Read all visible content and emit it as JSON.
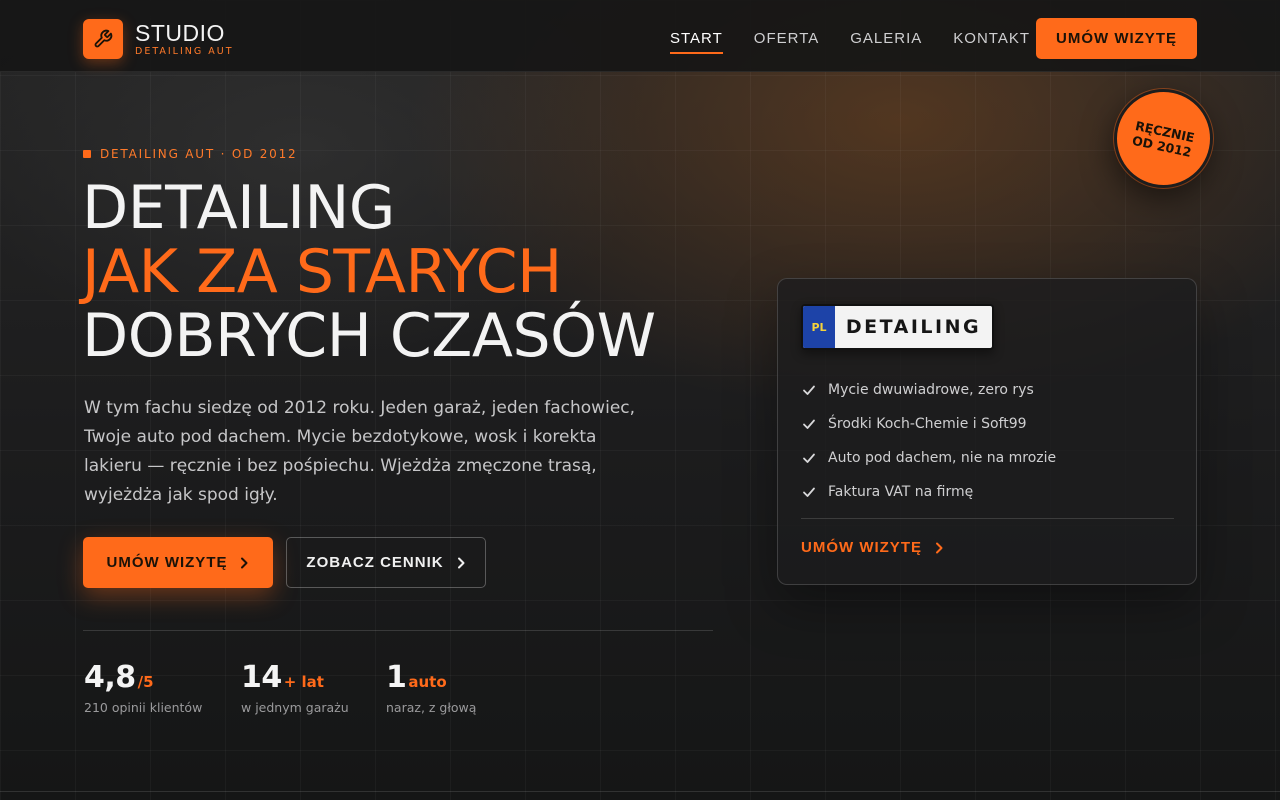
{
  "brand": {
    "title": "STUDIO",
    "subtitle": "DETAILING AUT",
    "icon": "wrench-icon",
    "accent_color": "#ff6a1a"
  },
  "nav": {
    "items": [
      {
        "label": "START",
        "active": true
      },
      {
        "label": "OFERTA",
        "active": false
      },
      {
        "label": "GALERIA",
        "active": false
      },
      {
        "label": "KONTAKT",
        "active": false
      }
    ],
    "cta_label": "UMÓW WIZYTĘ"
  },
  "badge": {
    "line1": "RĘCZNIE",
    "line2": "OD 2012"
  },
  "hero": {
    "eyebrow": "DETAILING AUT · OD 2012",
    "title_line1": "DETAILING",
    "title_line2": "JAK ZA STARYCH",
    "title_line3": "DOBRYCH CZASÓW",
    "description": "W tym fachu siedzę od 2012 roku. Jeden garaż, jeden fachowiec, Twoje auto pod dachem. Mycie bezdotykowe, wosk i korekta lakieru — ręcznie i bez pośpiechu. Wjeżdża zmęczone trasą, wyjeżdża jak spod igły.",
    "primary_button": "UMÓW WIZYTĘ",
    "secondary_button": "ZOBACZ CENNIK"
  },
  "stats": [
    {
      "value": "4,8",
      "suffix": "/5",
      "label": "210 opinii klientów"
    },
    {
      "value": "14",
      "suffix": "+ lat",
      "label": "w jednym garażu"
    },
    {
      "value": "1",
      "suffix": "auto",
      "label": "naraz, z głową"
    }
  ],
  "card": {
    "plate_country": "PL",
    "plate_text": "DETAILING",
    "features": [
      "Mycie dwuwiadrowe, zero rys",
      "Środki Koch-Chemie i Soft99",
      "Auto pod dachem, nie na mrozie",
      "Faktura VAT na firmę"
    ],
    "link_label": "UMÓW WIZYTĘ"
  }
}
